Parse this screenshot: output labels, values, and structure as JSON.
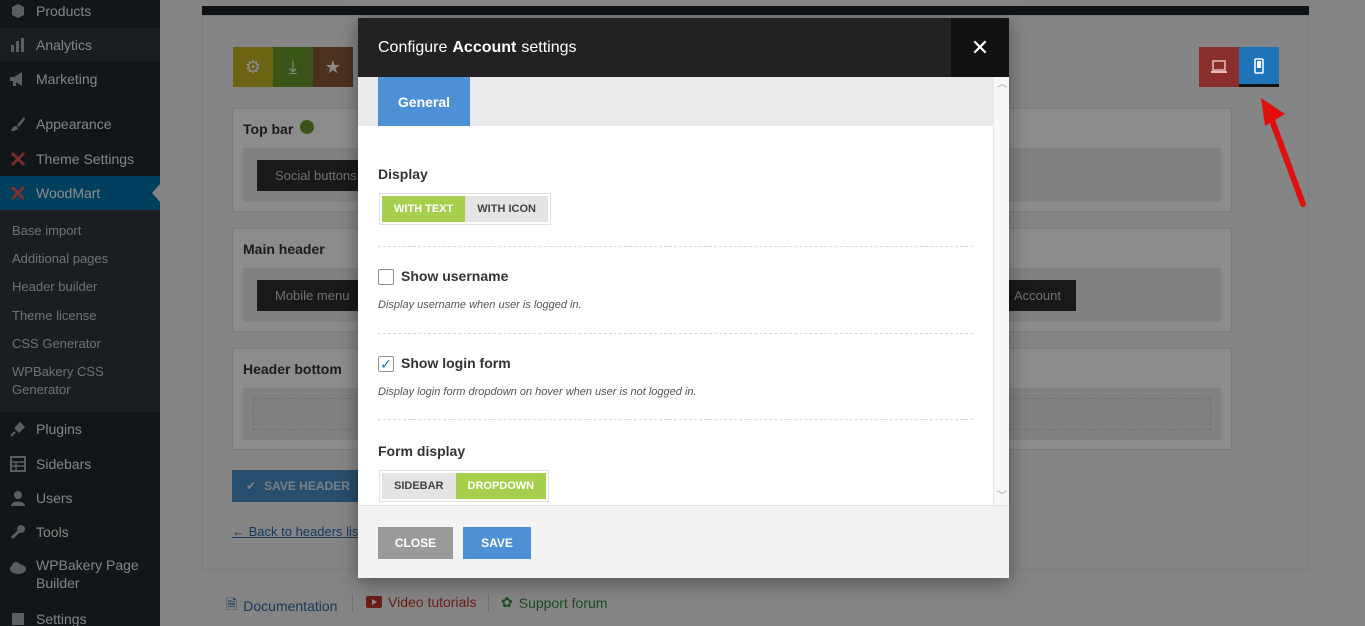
{
  "sidebar": {
    "items": [
      {
        "label": "Products",
        "icon": "archive-icon"
      },
      {
        "label": "Analytics",
        "icon": "bar-chart-icon"
      },
      {
        "label": "Marketing",
        "icon": "megaphone-icon"
      },
      {
        "label": "Appearance",
        "icon": "paintbrush-icon"
      },
      {
        "label": "Theme Settings",
        "icon": "woodmart-icon"
      },
      {
        "label": "WoodMart",
        "icon": "woodmart-icon"
      }
    ],
    "submenu": [
      "Base import",
      "Additional pages",
      "Header builder",
      "Theme license",
      "CSS Generator",
      "WPBakery CSS Generator"
    ],
    "items_bottom": [
      {
        "label": "Plugins",
        "icon": "plug-icon"
      },
      {
        "label": "Sidebars",
        "icon": "grid-icon"
      },
      {
        "label": "Users",
        "icon": "user-icon"
      },
      {
        "label": "Tools",
        "icon": "wrench-icon"
      },
      {
        "label": "WPBakery Page Builder",
        "icon": "cloud-icon"
      },
      {
        "label": "Settings",
        "icon": "settings-icon"
      }
    ]
  },
  "background": {
    "sections": [
      {
        "title": "Top bar",
        "chip": "Social buttons"
      },
      {
        "title": "Main header",
        "chip": "Mobile menu",
        "chip_right": "Account"
      },
      {
        "title": "Header bottom"
      }
    ],
    "save_header": "SAVE HEADER",
    "back_link": "← Back to headers list",
    "footer": {
      "documentation": "Documentation",
      "video": "Video tutorials",
      "support": "Support forum"
    },
    "colors": {
      "green_dot": "#6a9a2a",
      "settings_btn": "#c5b424",
      "import_btn": "#6a9a2a",
      "star_btn": "#8a5a3a",
      "desktop_btn": "#c04040",
      "mobile_btn": "#1f73b7"
    }
  },
  "modal": {
    "title_pre": "Configure",
    "title_bold": "Account",
    "title_post": "settings",
    "tab": "General",
    "display": {
      "label": "Display",
      "options": [
        "WITH TEXT",
        "WITH ICON"
      ],
      "selected": "WITH TEXT"
    },
    "show_username": {
      "label": "Show username",
      "checked": false,
      "desc": "Display username when user is logged in."
    },
    "show_login_form": {
      "label": "Show login form",
      "checked": true,
      "desc": "Display login form dropdown on hover when user is not logged in."
    },
    "form_display": {
      "label": "Form display",
      "options": [
        "SIDEBAR",
        "DROPDOWN"
      ],
      "selected": "DROPDOWN"
    },
    "close": "CLOSE",
    "save": "SAVE"
  }
}
